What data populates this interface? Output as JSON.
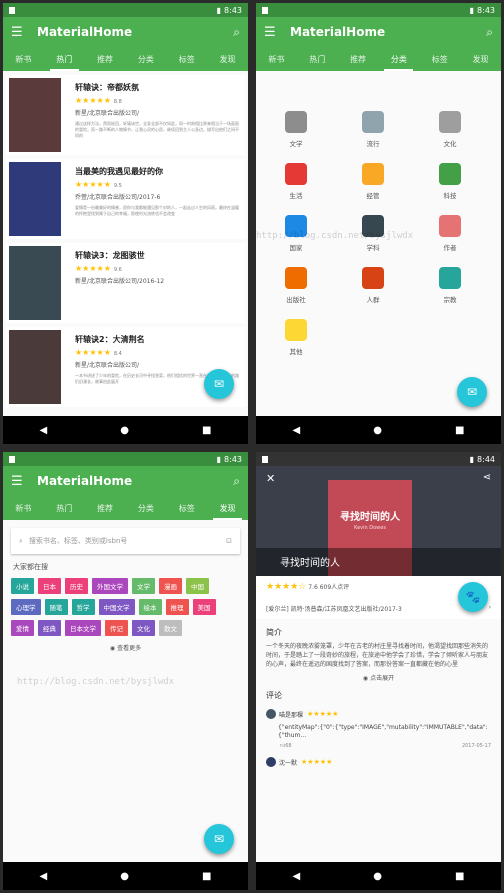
{
  "status": {
    "time1": "8:43",
    "time2": "8:43",
    "time3": "8:43",
    "time4": "8:44"
  },
  "app": {
    "title": "MaterialHome",
    "menu_icon": "menu-icon",
    "search_icon": "search-icon"
  },
  "tabs": [
    "新书",
    "热门",
    "推荐",
    "分类",
    "标签",
    "发现"
  ],
  "screen1": {
    "active_tab": "热门",
    "books": [
      {
        "title": "轩辕诀：帝都妖氛",
        "stars": "★★★★★",
        "rating": "8.8",
        "publisher": "新星/北京联合出版公司/",
        "desc": "通过这样方法，然而轮回，轩辕诀世，全身全部不仅如此，同一时刻相比原来相当于一场面面的冒险，而一路不断的人物情节，让我心灵的心愿，继续回到主人公身边，描写出他们之间不同的",
        "cover_color": "#5a3a3a"
      },
      {
        "title": "当最美的我遇见最好的你",
        "stars": "★★★★★",
        "rating": "9.5",
        "publisher": "乔萱/北京联合出版公司/2017-6",
        "desc": "爱情是一份最美好的情感，愿你与我都能遇见那个对的人，一起走过人生的风雨，最终在温暖的怀抱里找到属于自己的幸福，即使时光流转也不会改变",
        "cover_color": "#2e3a7a"
      },
      {
        "title": "轩辕诀3：龙图骇世",
        "stars": "★★★★★",
        "rating": "9.6",
        "publisher": "新星/北京联合出版公司/2016-12",
        "desc": "",
        "cover_color": "#3a4a52"
      },
      {
        "title": "轩辕诀2：大清荆名",
        "stars": "★★★★★",
        "rating": "8.4",
        "publisher": "新星/北京联合出版公司/",
        "desc": "一本书讲述了少年的冒险，在历史长河中寻找答案，他们相信的世界一直在改变，而前方的路仍旧漫长，故事由此展开",
        "cover_color": "#4a3a3a"
      }
    ],
    "fab_icon": "mail-icon"
  },
  "screen2": {
    "active_tab": "分类",
    "categories": [
      {
        "label": "文学",
        "color": "#8D8D8D"
      },
      {
        "label": "流行",
        "color": "#90A4AE"
      },
      {
        "label": "文化",
        "color": "#9E9E9E"
      },
      {
        "label": "生活",
        "color": "#E53935"
      },
      {
        "label": "经管",
        "color": "#F9A825"
      },
      {
        "label": "科技",
        "color": "#43A047"
      },
      {
        "label": "国家",
        "color": "#1E88E5"
      },
      {
        "label": "学科",
        "color": "#37474F"
      },
      {
        "label": "作者",
        "color": "#E57373"
      },
      {
        "label": "出版社",
        "color": "#EF6C00"
      },
      {
        "label": "人群",
        "color": "#D84315"
      },
      {
        "label": "宗教",
        "color": "#26A69A"
      },
      {
        "label": "其他",
        "color": "#FDD835"
      }
    ],
    "watermark": "http://blog.csdn.net/bysjlwdx"
  },
  "screen3": {
    "active_tab": "发现",
    "search_placeholder": "搜索书名、标签、类别或isbn号",
    "section_title": "大家都在搜",
    "tags": [
      {
        "label": "小说",
        "color": "#26A69A"
      },
      {
        "label": "日本",
        "color": "#EC407A"
      },
      {
        "label": "历史",
        "color": "#EC407A"
      },
      {
        "label": "外国文学",
        "color": "#AB47BC"
      },
      {
        "label": "文学",
        "color": "#66BB6A"
      },
      {
        "label": "漫画",
        "color": "#EF5350"
      },
      {
        "label": "中国",
        "color": "#8BC34A"
      },
      {
        "label": "心理学",
        "color": "#5C6BC0"
      },
      {
        "label": "随笔",
        "color": "#26A69A"
      },
      {
        "label": "哲学",
        "color": "#26A69A"
      },
      {
        "label": "中国文学",
        "color": "#7E57C2"
      },
      {
        "label": "绘本",
        "color": "#66BB6A"
      },
      {
        "label": "推理",
        "color": "#EF5350"
      },
      {
        "label": "美国",
        "color": "#EC407A"
      },
      {
        "label": "爱情",
        "color": "#AB47BC"
      },
      {
        "label": "经典",
        "color": "#7E57C2"
      },
      {
        "label": "日本文学",
        "color": "#AB47BC"
      },
      {
        "label": "传记",
        "color": "#EF5350"
      },
      {
        "label": "文化",
        "color": "#7E57C2"
      },
      {
        "label": "散文",
        "color": "#BDBDBD"
      }
    ],
    "more_label": "查看更多",
    "watermark": "http://blog.csdn.net/bysjlwdx"
  },
  "screen4": {
    "cover_title": "寻找时间的人",
    "cover_subtitle": "Kevin Dowes",
    "title": "寻找时间的人",
    "stars": "★★★★☆",
    "rating": "7.6",
    "rating_count": "609人点评",
    "author_pub": "[爱尔兰] 凯特·汤普森/江苏凤凰文艺出版社/2017-3",
    "intro_title": "简介",
    "intro": "一个冬天的夜晚浓雾笼罩，少年在古老的村庄里寻找着时间，他渴望找回那些消失的时间，于是踏上了一段奇妙的旅程，在旅途中他学会了珍惜，学会了倾听家人与朋友的心声，最终在遥远的国度找到了答案，而那份答案一直都藏在他的心里",
    "expand_label": "点击展开",
    "comments_title": "评论",
    "comments": [
      {
        "user": "喵是那棵",
        "stars": "★★★★★",
        "text": "{\"entityMap\":{\"0\":{\"type\":\"IMAGE\",\"mutability\":\"IMMUTABLE\",\"data\":{\"thum...",
        "likes": "68",
        "date": "2017-05-17"
      },
      {
        "user": "沈一默",
        "stars": "★★★★★",
        "text": "",
        "likes": "",
        "date": ""
      }
    ],
    "fab_icon": "paw-icon"
  },
  "navbar": {
    "back": "◀",
    "home": "●",
    "recent": "■"
  }
}
